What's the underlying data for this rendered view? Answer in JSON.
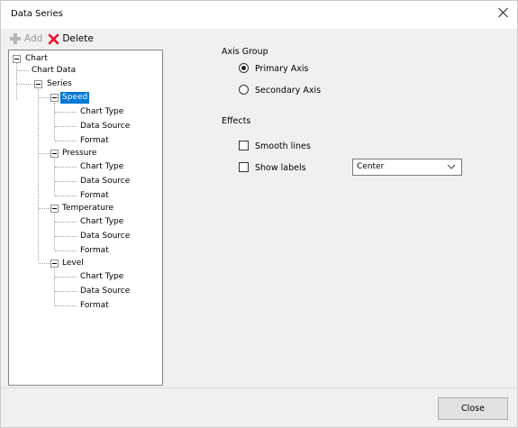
{
  "window": {
    "title": "Data Series"
  },
  "toolbar": {
    "add_label": "Add",
    "delete_label": "Delete"
  },
  "tree": {
    "root": "Chart",
    "chart_data": "Chart Data",
    "series": "Series",
    "items": [
      {
        "label": "Speed",
        "children": [
          "Chart Type",
          "Data Source",
          "Format"
        ]
      },
      {
        "label": "Pressure",
        "children": [
          "Chart Type",
          "Data Source",
          "Format"
        ]
      },
      {
        "label": "Temperature",
        "children": [
          "Chart Type",
          "Data Source",
          "Format"
        ]
      },
      {
        "label": "Level",
        "children": [
          "Chart Type",
          "Data Source",
          "Format"
        ]
      }
    ]
  },
  "axis_group": {
    "label": "Axis Group",
    "primary": "Primary Axis",
    "secondary": "Secondary Axis"
  },
  "effects": {
    "label": "Effects",
    "smooth_lines": "Smooth lines",
    "show_labels": "Show labels",
    "label_position": "Center"
  },
  "footer": {
    "close_label": "Close"
  },
  "colors": {
    "selection": "#0078d7",
    "delete": "#e81123"
  }
}
